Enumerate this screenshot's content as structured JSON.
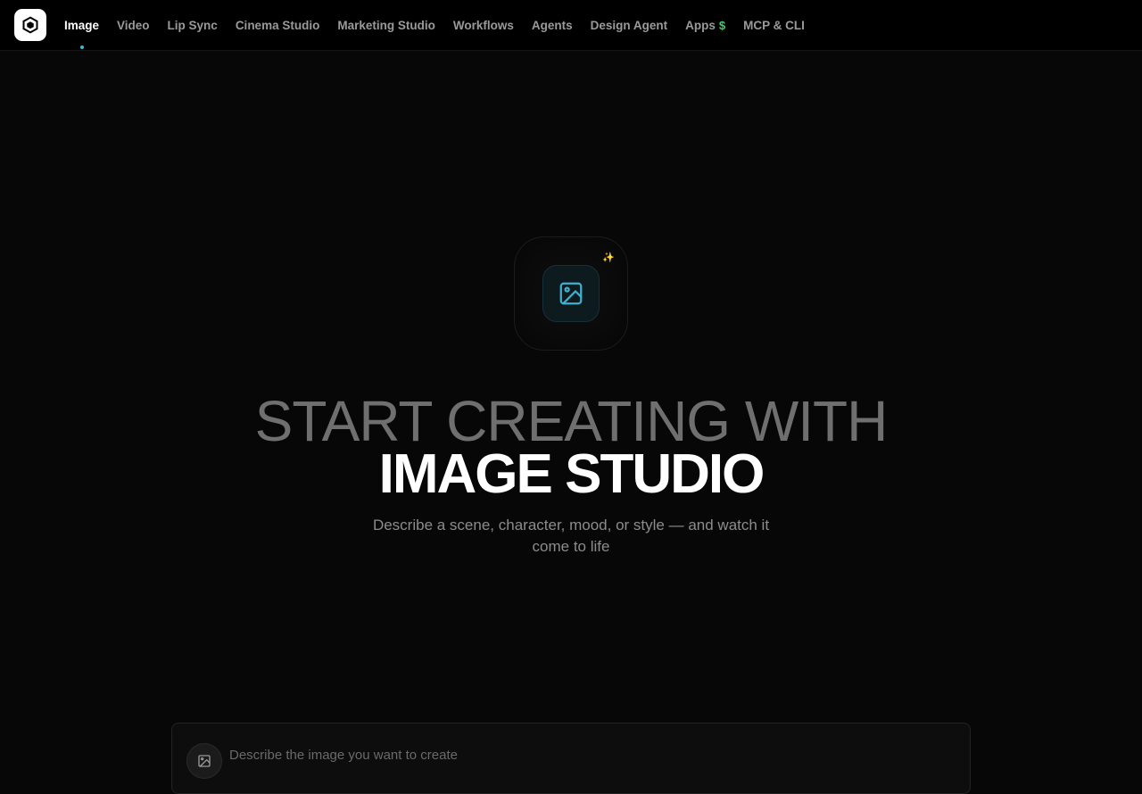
{
  "nav": {
    "items": [
      {
        "label": "Image",
        "active": true
      },
      {
        "label": "Video"
      },
      {
        "label": "Lip Sync"
      },
      {
        "label": "Cinema Studio"
      },
      {
        "label": "Marketing Studio"
      },
      {
        "label": "Workflows"
      },
      {
        "label": "Agents"
      },
      {
        "label": "Design Agent"
      },
      {
        "label": "Apps"
      },
      {
        "label": "MCP & CLI"
      }
    ],
    "apps_badge": "$"
  },
  "hero": {
    "icon": "image-icon",
    "sparkle": "✨",
    "headline_line1": "START CREATING WITH",
    "headline_line2": "IMAGE STUDIO",
    "subtitle": "Describe a scene, character, mood, or style — and watch it come to life"
  },
  "prompt": {
    "placeholder": "Describe the image you want to create"
  },
  "colors": {
    "accent": "#3fb8d8",
    "apps_badge": "#3ecf6e",
    "background": "#070707"
  }
}
